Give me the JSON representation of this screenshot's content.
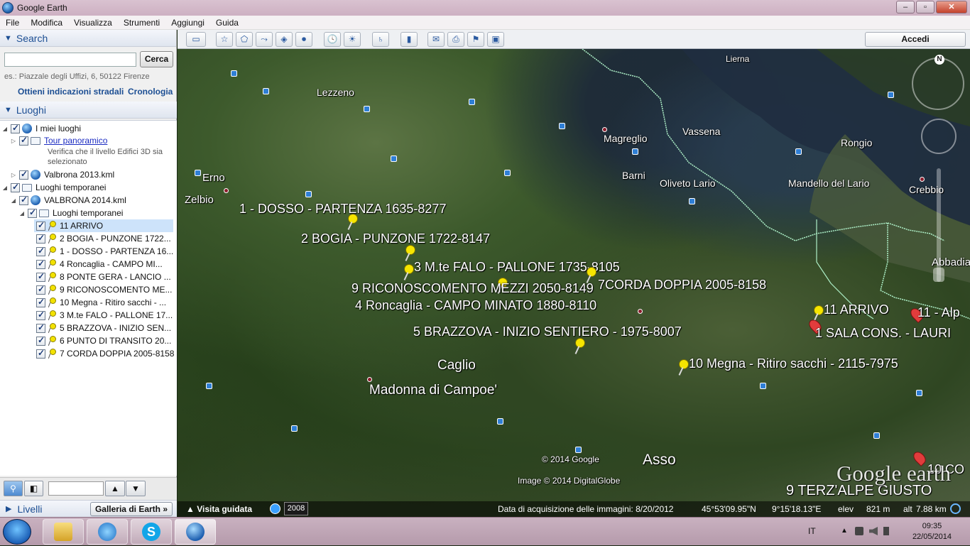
{
  "window": {
    "title": "Google Earth",
    "minimize": "–",
    "maximize": "▫",
    "close": "✕"
  },
  "menu": [
    "File",
    "Modifica",
    "Visualizza",
    "Strumenti",
    "Aggiungi",
    "Guida"
  ],
  "search": {
    "header": "Search",
    "input_value": "",
    "button": "Cerca",
    "hint": "es.: Piazzale degli Uffizi, 6, 50122 Firenze",
    "directions": "Ottieni indicazioni stradali",
    "history": "Cronologia"
  },
  "places": {
    "header": "Luoghi",
    "my_places": "I miei luoghi",
    "tour": "Tour panoramico",
    "tour_note": "Verifica che il livello Edifici 3D sia selezionato",
    "valbrona2013": "Valbrona 2013.kml",
    "temp": "Luoghi temporanei",
    "valbrona2014": "VALBRONA 2014.kml",
    "temp_inner": "Luoghi temporanei",
    "items": [
      "11 ARRIVO",
      "2 BOGIA - PUNZONE 1722...",
      "1 - DOSSO - PARTENZA 16...",
      "4 Roncaglia - CAMPO MI...",
      "8 PONTE GERA - LANCIO ...",
      "9 RICONOSCOMENTO ME...",
      "10 Megna - Ritiro sacchi - ...",
      "3 M.te FALO - PALLONE 17...",
      "5 BRAZZOVA - INIZIO SEN...",
      "6 PUNTO DI TRANSITO 20...",
      "7 CORDA DOPPIA 2005-8158"
    ]
  },
  "layers": {
    "header": "Livelli",
    "gallery": "Galleria di Earth »"
  },
  "toolbar": {
    "signin": "Accedi"
  },
  "map": {
    "towns": [
      "Lierna",
      "Lezzeno",
      "Vassena",
      "Magreglio",
      "Rongio",
      "Barni",
      "Erno",
      "Oliveto Lario",
      "Mandello del Lario",
      "Crebbio",
      "Zelbio",
      "Abbadia L",
      "Caglio",
      "Madonna di Campoe'",
      "Asso"
    ],
    "placemarks": [
      "1 - DOSSO - PARTENZA 1635-8277",
      "2 BOGIA - PUNZONE 1722-8147",
      "3 M.te FALO - PALLONE 1735-8105",
      "9 RICONOSCOMENTO MEZZI 2050-8149",
      "7CORDA DOPPIA 2005-8158",
      "4 Roncaglia - CAMPO MINATO 1880-8110",
      "5 BRAZZOVA - INIZIO SENTIERO - 1975-8007",
      "10 Megna - Ritiro sacchi - 2115-7975",
      "11 ARRIVO",
      "11 - Alp",
      "1 SALA CONS. - LAURI",
      "10 CO",
      "9 TERZ'ALPE GIUSTO"
    ],
    "copyright1": "© 2014 Google",
    "copyright2": "Image © 2014 DigitalGlobe",
    "logo": "Google earth",
    "compass_n": "N"
  },
  "status": {
    "tour": "Visita guidata",
    "year": "2008",
    "date": "Data di acquisizione delle immagini: 8/20/2012",
    "lat": "45°53'09.95\"N",
    "lon": "9°15'18.13\"E",
    "elev_label": "elev",
    "elev": "821 m",
    "alt_label": "alt",
    "alt": "7.88 km"
  },
  "taskbar": {
    "lang": "IT",
    "time": "09:35",
    "date": "22/05/2014"
  }
}
